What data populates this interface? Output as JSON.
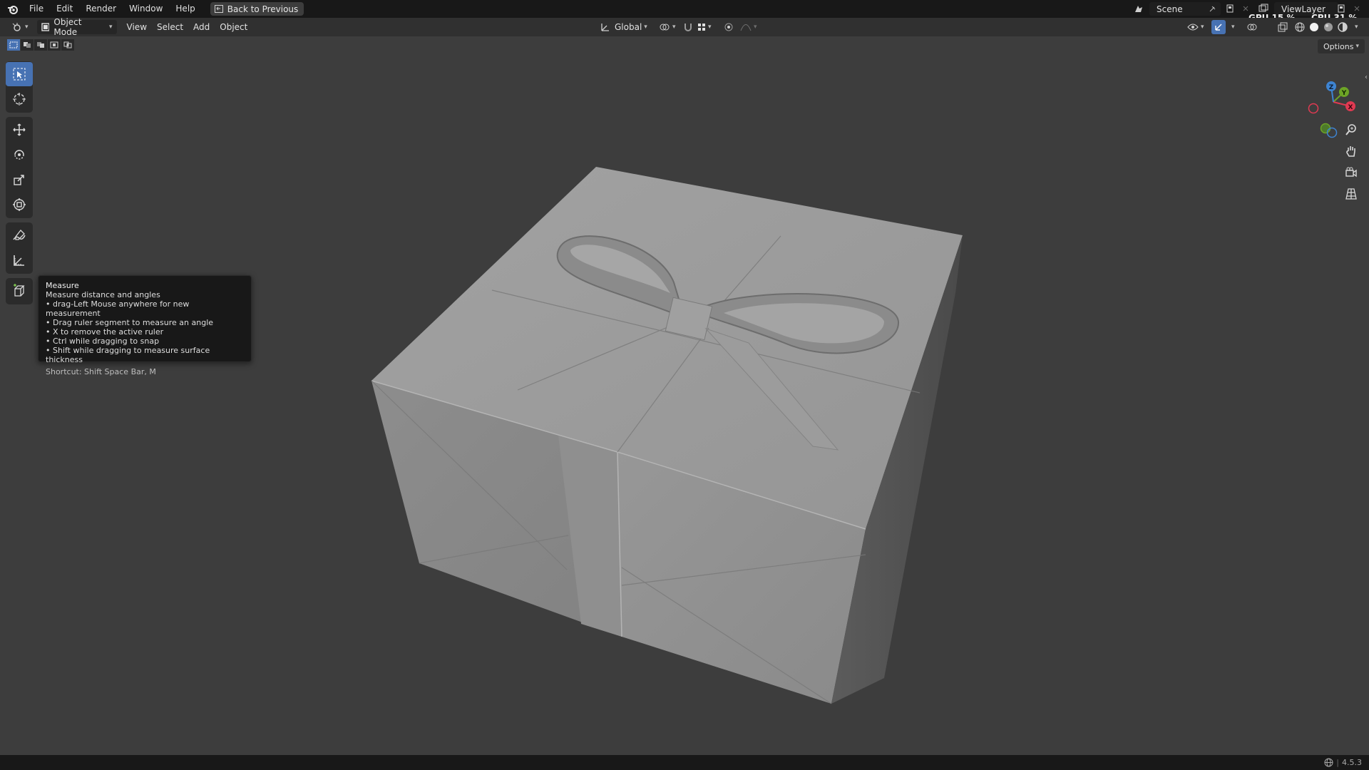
{
  "menu": {
    "items": [
      "File",
      "Edit",
      "Render",
      "Window",
      "Help"
    ],
    "back_button": "Back to Previous"
  },
  "top_right": {
    "scene": "Scene",
    "view_layer": "ViewLayer",
    "gpu_label": "GPU",
    "gpu_value": "15 %",
    "cpu_label": "CPU",
    "cpu_value": "31 %"
  },
  "header": {
    "mode": "Object Mode",
    "menus": [
      "View",
      "Select",
      "Add",
      "Object"
    ],
    "transform_orientation": "Global"
  },
  "viewport": {
    "options": "Options",
    "gizmo_axes": [
      "Z",
      "Y",
      "X"
    ]
  },
  "tooltip": {
    "title": "Measure",
    "description": "Measure distance and angles",
    "lines": [
      "• drag-Left Mouse anywhere for new measurement",
      "• Drag ruler segment to measure an angle",
      "• X to remove the active ruler",
      "• Ctrl while dragging to snap",
      "• Shift while dragging to measure surface thickness"
    ],
    "shortcut": "Shortcut: Shift Space Bar, M"
  },
  "toolbar": {
    "tools": [
      "select-box",
      "cursor",
      "move",
      "rotate",
      "scale",
      "transform",
      "annotate",
      "measure",
      "add-cube"
    ]
  },
  "status": {
    "version": "4.5.3"
  },
  "colors": {
    "accent": "#4772b3",
    "viewport_bg": "#3d3d3d",
    "topbar_bg": "#181818",
    "header_bg": "#303030",
    "axis_x": "#e03a52",
    "axis_y": "#6da426",
    "axis_z": "#3e84d2"
  }
}
